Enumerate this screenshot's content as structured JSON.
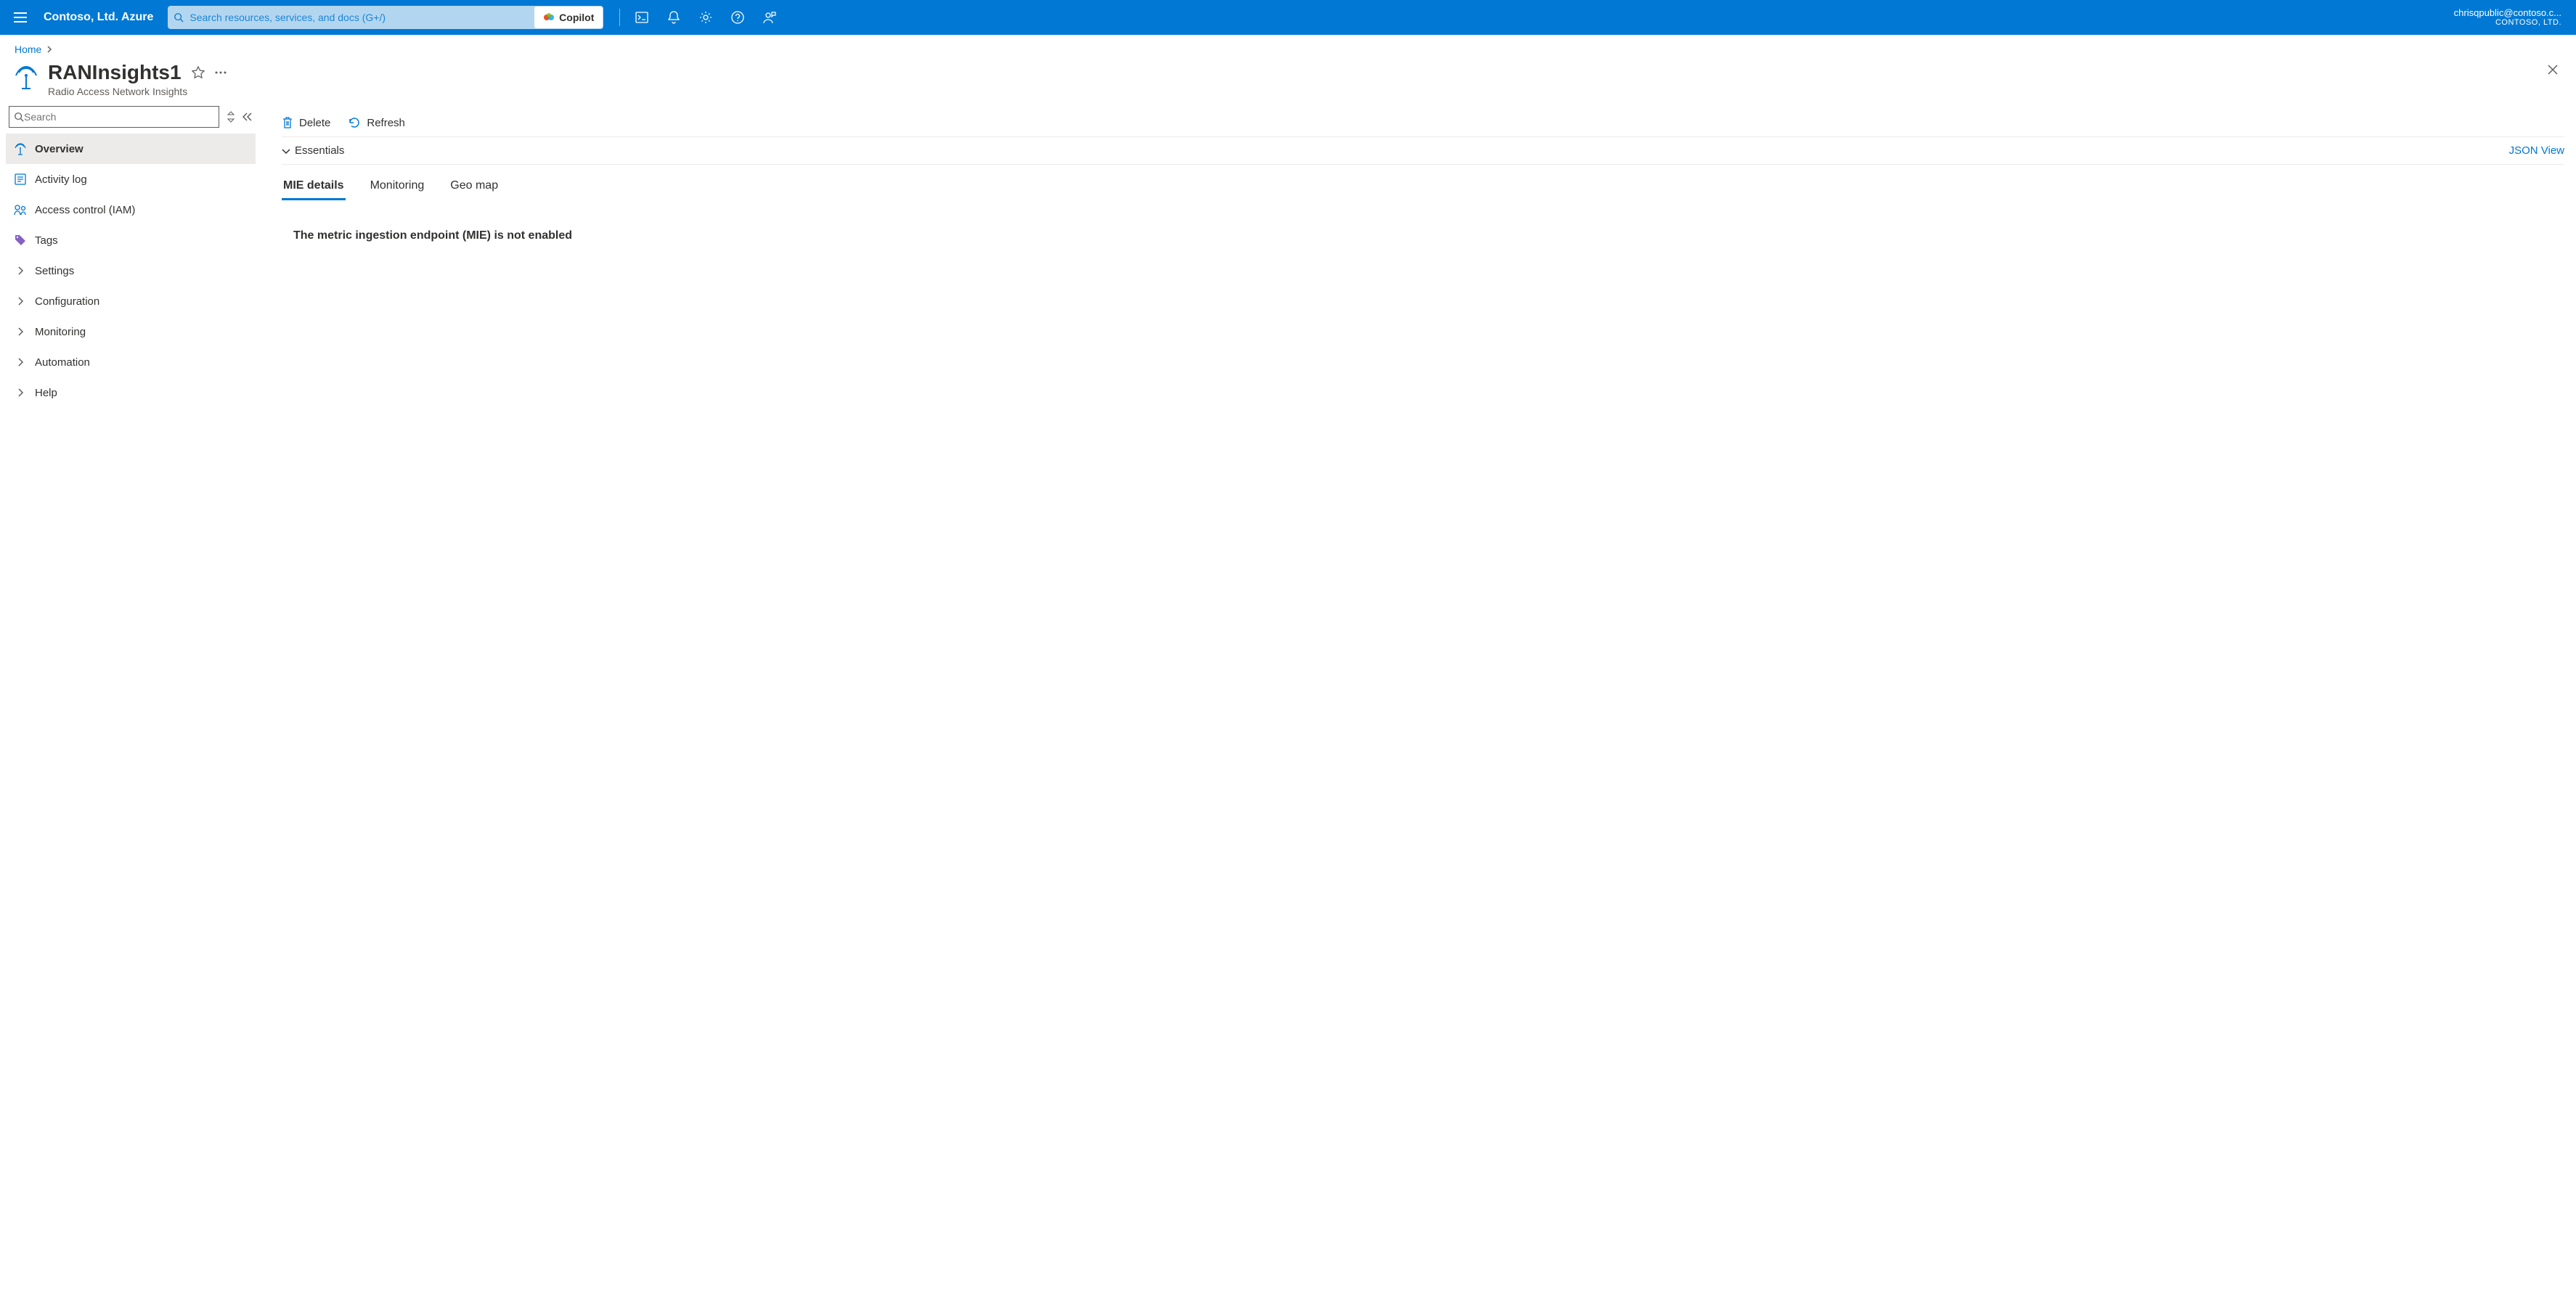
{
  "topbar": {
    "brand": "Contoso, Ltd. Azure",
    "search_placeholder": "Search resources, services, and docs (G+/)",
    "copilot_label": "Copilot",
    "account_email": "chrisqpublic@contoso.c...",
    "account_tenant": "CONTOSO, LTD."
  },
  "breadcrumb": {
    "home": "Home"
  },
  "resource": {
    "title": "RANInsights1",
    "subtitle": "Radio Access Network Insights"
  },
  "sidebar": {
    "search_placeholder": "Search",
    "items": [
      {
        "label": "Overview"
      },
      {
        "label": "Activity log"
      },
      {
        "label": "Access control (IAM)"
      },
      {
        "label": "Tags"
      },
      {
        "label": "Settings"
      },
      {
        "label": "Configuration"
      },
      {
        "label": "Monitoring"
      },
      {
        "label": "Automation"
      },
      {
        "label": "Help"
      }
    ]
  },
  "commands": {
    "delete": "Delete",
    "refresh": "Refresh"
  },
  "essentials": {
    "label": "Essentials",
    "json_view": "JSON View"
  },
  "tabs": {
    "mie": "MIE details",
    "monitoring": "Monitoring",
    "geo": "Geo map"
  },
  "content": {
    "mie_message": "The metric ingestion endpoint (MIE) is not enabled"
  }
}
